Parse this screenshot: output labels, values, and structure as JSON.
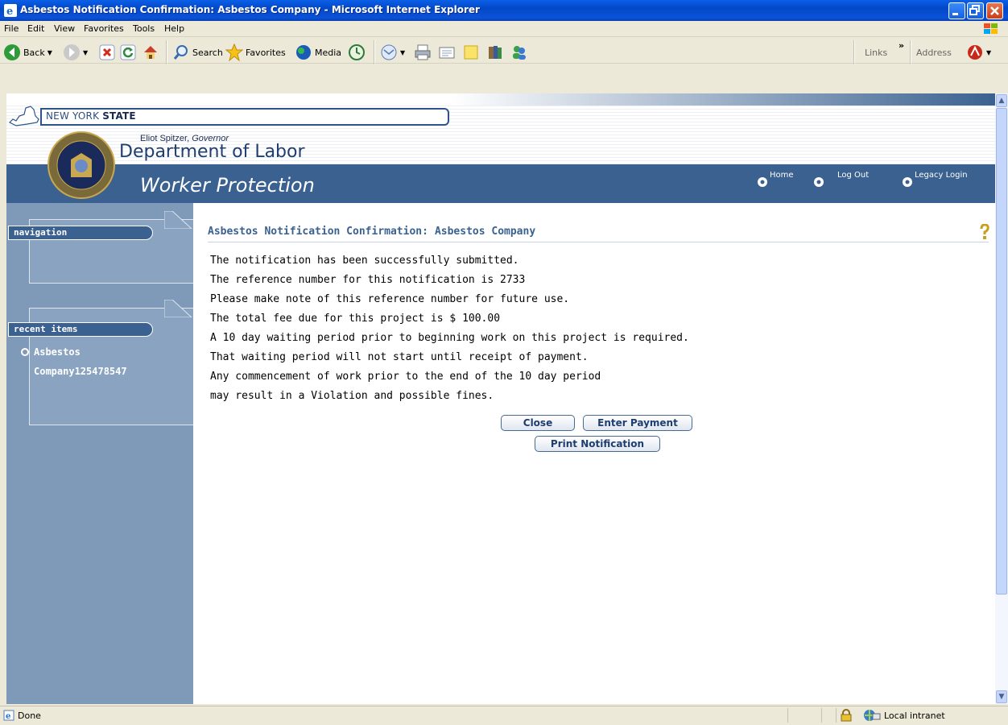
{
  "window": {
    "title": "Asbestos Notification Confirmation: Asbestos Company - Microsoft Internet Explorer"
  },
  "menu": [
    "File",
    "Edit",
    "View",
    "Favorites",
    "Tools",
    "Help"
  ],
  "toolbar": {
    "back": "Back",
    "search": "Search",
    "favorites": "Favorites",
    "media": "Media",
    "links": "Links",
    "address": "Address"
  },
  "header": {
    "state_prefix": "NEW YORK ",
    "state_bold": "STATE",
    "governor_name": "Eliot Spitzer, ",
    "governor_title": "Governor",
    "department": "Department of Labor",
    "section": "Worker Protection",
    "links": [
      "Home",
      "Log Out",
      "Legacy Login"
    ]
  },
  "sidebar": {
    "navigation_label": "navigation",
    "recent_label": "recent items",
    "recent_items": [
      "Asbestos",
      "Company125478547"
    ]
  },
  "content": {
    "title_prefix": "Asbestos Notification Confirmation:",
    "title_company": "Asbestos Company",
    "lines": [
      "The notification has been successfully submitted.",
      "The reference number for this notification is  2733",
      "Please make note of this reference number for future use.",
      "The total fee due for this project is $ 100.00",
      "A 10 day waiting period prior to beginning work on this project is required.",
      "That waiting period will not start until receipt of payment.",
      "Any commencement of work prior to the end of the 10 day period",
      "may result in a Violation and possible fines."
    ],
    "buttons": {
      "close": "Close",
      "enter_payment": "Enter Payment",
      "print": "Print Notification"
    }
  },
  "status": {
    "text": "Done",
    "zone": "Local intranet"
  }
}
